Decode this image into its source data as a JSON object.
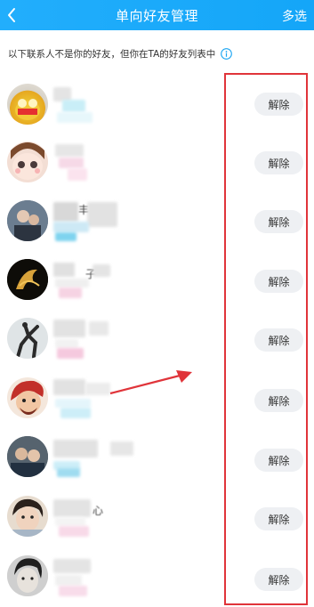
{
  "header": {
    "back_icon": "chevron-left-icon",
    "title": "单向好友管理",
    "multi_select": "多选",
    "color": "#18a9fa"
  },
  "hint": {
    "text": "以下联系人不是你的好友，但你在TA的好友列表中",
    "info_icon": "info-icon"
  },
  "contacts": [
    {
      "name": "",
      "action": "解除"
    },
    {
      "name": "",
      "action": "解除"
    },
    {
      "name": "丰",
      "action": "解除"
    },
    {
      "name": "子",
      "action": "解除"
    },
    {
      "name": "",
      "action": "解除"
    },
    {
      "name": "",
      "action": "解除"
    },
    {
      "name": "",
      "action": "解除"
    },
    {
      "name": "心",
      "action": "解除"
    },
    {
      "name": "",
      "action": "解除"
    }
  ],
  "highlight_color": "#e0343a"
}
